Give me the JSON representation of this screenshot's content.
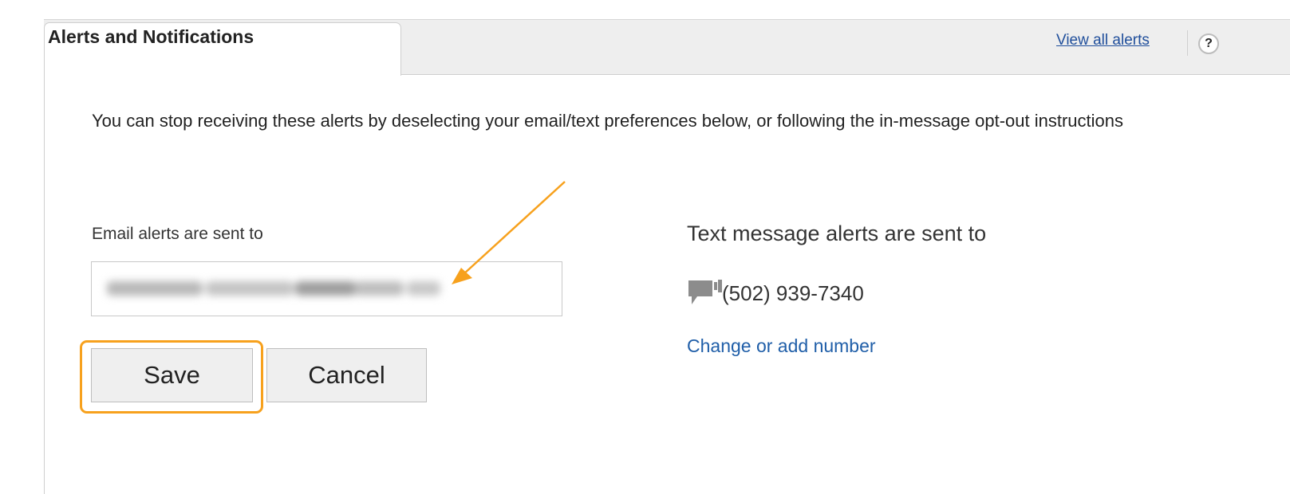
{
  "tab": {
    "title": "Alerts and Notifications"
  },
  "header": {
    "view_all_link": "View all alerts",
    "help_label": "?"
  },
  "intro_text": "You can stop receiving these alerts by deselecting your email/text preferences below, or following the in-message opt-out instructions",
  "email": {
    "label": "Email alerts are sent to",
    "value_obscured": true
  },
  "buttons": {
    "save_label": "Save",
    "cancel_label": "Cancel"
  },
  "text_alerts": {
    "label": "Text message alerts are sent to",
    "phone_number": "(502) 939-7340",
    "change_link": "Change or add number"
  },
  "icons": {
    "help": "question-mark-icon",
    "sms": "chat-bubble-icon"
  },
  "colors": {
    "link": "#1f5ea8",
    "annotation_accent": "#f7a11d",
    "button_bg": "#efefef",
    "tab_strip_bg": "#eeeeee"
  }
}
